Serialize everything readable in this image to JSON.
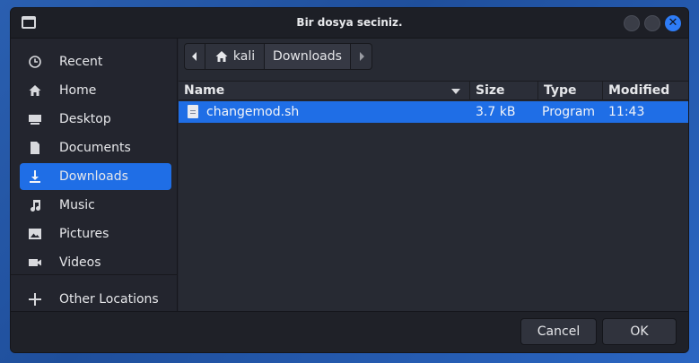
{
  "window": {
    "title": "Bir dosya seciniz."
  },
  "sidebar": {
    "items": [
      {
        "label": "Recent",
        "icon": "clock-icon"
      },
      {
        "label": "Home",
        "icon": "home-icon"
      },
      {
        "label": "Desktop",
        "icon": "desktop-icon"
      },
      {
        "label": "Documents",
        "icon": "document-icon"
      },
      {
        "label": "Downloads",
        "icon": "download-icon",
        "active": true
      },
      {
        "label": "Music",
        "icon": "music-icon"
      },
      {
        "label": "Pictures",
        "icon": "picture-icon"
      },
      {
        "label": "Videos",
        "icon": "video-icon"
      },
      {
        "label": "Other Locations",
        "icon": "plus-icon"
      }
    ]
  },
  "pathbar": {
    "segments": [
      "kali",
      "Downloads"
    ]
  },
  "table": {
    "columns": [
      "Name",
      "Size",
      "Type",
      "Modified"
    ],
    "rows": [
      {
        "name": "changemod.sh",
        "size": "3.7 kB",
        "type": "Program",
        "modified": "11:43",
        "selected": true
      }
    ]
  },
  "footer": {
    "cancel_label": "Cancel",
    "ok_label": "OK"
  },
  "colors": {
    "accent": "#1f6ee6",
    "window_bg": "#23252e",
    "content_bg": "#272a33"
  }
}
